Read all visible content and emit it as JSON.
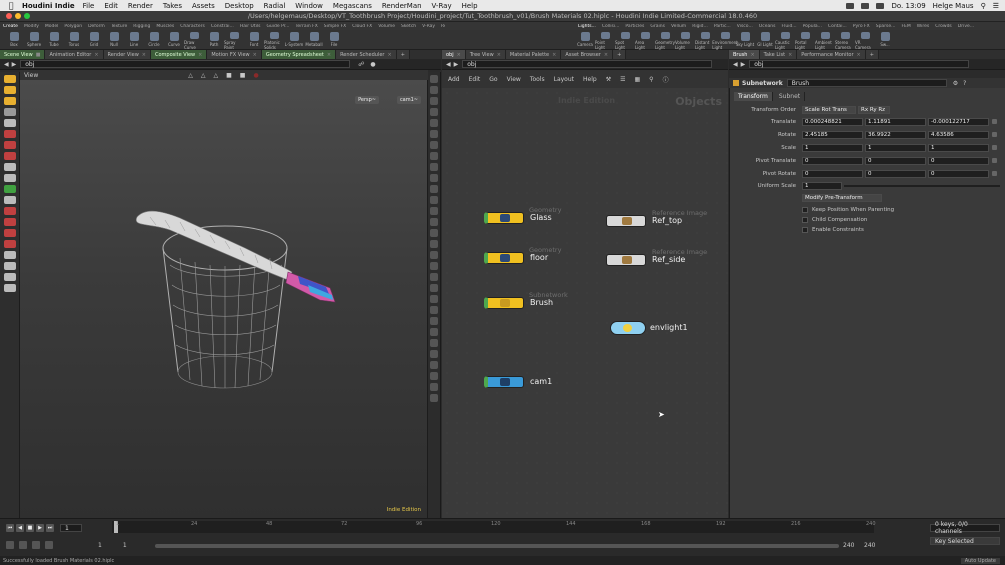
{
  "menubar": {
    "app_name": "Houdini Indie",
    "items": [
      "File",
      "Edit",
      "Render",
      "Takes",
      "Assets",
      "Desktop",
      "Radial",
      "Window",
      "Megascans",
      "RenderMan",
      "V-Ray",
      "Help"
    ],
    "clock": "Do. 13:09",
    "user": "Helge Maus"
  },
  "window": {
    "title": "/Users/helgemaus/Desktop/VT_Toothbrush Project/Houdini_project/Tut_Toothbrush_v01/Brush Materials 02.hiplc - Houdini Indie Limited-Commercial 18.0.460"
  },
  "shelf": {
    "tabs_left": [
      "Create",
      "Modify",
      "Model",
      "Polygon",
      "Deform",
      "Texture",
      "Rigging",
      "Muscles",
      "Characters",
      "Constrai...",
      "Hair Utils",
      "Guide Pr...",
      "Terrain FX",
      "Simple FX",
      "Cloud FX",
      "Volume",
      "Sketch",
      "V-Ray",
      "RenderM...",
      "SideFX L...",
      "MOPs"
    ],
    "tabs_right": [
      "Lights...",
      "Collisi...",
      "Particles",
      "Grains",
      "Vellum",
      "Rigid...",
      "Partic...",
      "Visco...",
      "Oceans",
      "Fluid...",
      "Popula...",
      "Contai...",
      "Pyro FX",
      "Sparse...",
      "FEM",
      "Wires",
      "Crowds",
      "Drive..."
    ],
    "tools_left": [
      "Box",
      "Sphere",
      "Tube",
      "Torus",
      "Grid",
      "Null",
      "Line",
      "Circle",
      "Curve",
      "Draw Curve",
      "Path",
      "Spray Paint",
      "Font",
      "Platonic Solids",
      "L-System",
      "Metaball",
      "File"
    ],
    "tools_right": [
      "Camera",
      "Point Light",
      "Spot Light",
      "Area Light",
      "Geometry Light",
      "Volume Light",
      "Distant Light",
      "Environment Light",
      "Sky Light",
      "GI Light",
      "Caustic Light",
      "Portal Light",
      "Ambient Light",
      "Stereo Camera",
      "VR Camera",
      "Sw..."
    ]
  },
  "left_pane": {
    "tabs": [
      "Scene View",
      "Animation Editor",
      "Render View",
      "Composite View",
      "Motion FX View",
      "Geometry Spreadsheet",
      "Render Scheduler"
    ],
    "path": "obj",
    "viewport_label": "View",
    "persp": "Persp~",
    "cam": "cam1~",
    "indie_label": "Indie Edition"
  },
  "network_pane": {
    "tabs": [
      "obj",
      "Tree View",
      "Material Palette",
      "Asset Browser"
    ],
    "path": "obj",
    "menu": [
      "Add",
      "Edit",
      "Go",
      "View",
      "Tools",
      "Layout",
      "Help"
    ],
    "watermark": "Indie Edition",
    "context_label": "Objects",
    "nodes": [
      {
        "name": "Glass",
        "type": "Geometry"
      },
      {
        "name": "floor",
        "type": "Geometry"
      },
      {
        "name": "Brush",
        "type": "Subnetwork"
      },
      {
        "name": "cam1",
        "type": ""
      },
      {
        "name": "Ref_top",
        "type": "Reference Image"
      },
      {
        "name": "Ref_side",
        "type": "Reference Image"
      },
      {
        "name": "envlight1",
        "type": ""
      }
    ]
  },
  "param_pane": {
    "tabs": [
      "Brush",
      "Take List",
      "Performance Monitor"
    ],
    "path": "obj",
    "node_type": "Subnetwork",
    "node_name": "Brush",
    "subtabs": [
      "Transform",
      "Subnet"
    ],
    "transform_order_label": "Transform Order",
    "transform_order": "Scale Rot Trans",
    "rot_order": "Rx Ry Rz",
    "rows": [
      {
        "label": "Translate",
        "x": "0.000248821",
        "y": "1.11891",
        "z": "-0.000122717"
      },
      {
        "label": "Rotate",
        "x": "2.45185",
        "y": "36.9922",
        "z": "4.63586"
      },
      {
        "label": "Scale",
        "x": "1",
        "y": "1",
        "z": "1"
      },
      {
        "label": "Pivot Translate",
        "x": "0",
        "y": "0",
        "z": "0"
      },
      {
        "label": "Pivot Rotate",
        "x": "0",
        "y": "0",
        "z": "0"
      }
    ],
    "uniform_scale_label": "Uniform Scale",
    "uniform_scale": "1",
    "modify_pretransform": "Modify Pre-Transform",
    "checkboxes": [
      "Keep Position When Parenting",
      "Child Compensation",
      "Enable Constraints"
    ]
  },
  "timeline": {
    "current_frame": "1",
    "ticks": [
      "1",
      "24",
      "48",
      "72",
      "96",
      "120",
      "144",
      "168",
      "192",
      "216",
      "240"
    ],
    "start": "1",
    "range_start": "1",
    "range_end": "240",
    "end": "240",
    "keys_info": "0 keys, 0/0 channels",
    "key_selected": "Key Selected",
    "auto_update": "Auto Update",
    "status": "Successfully loaded Brush Materials 02.hiplc"
  }
}
